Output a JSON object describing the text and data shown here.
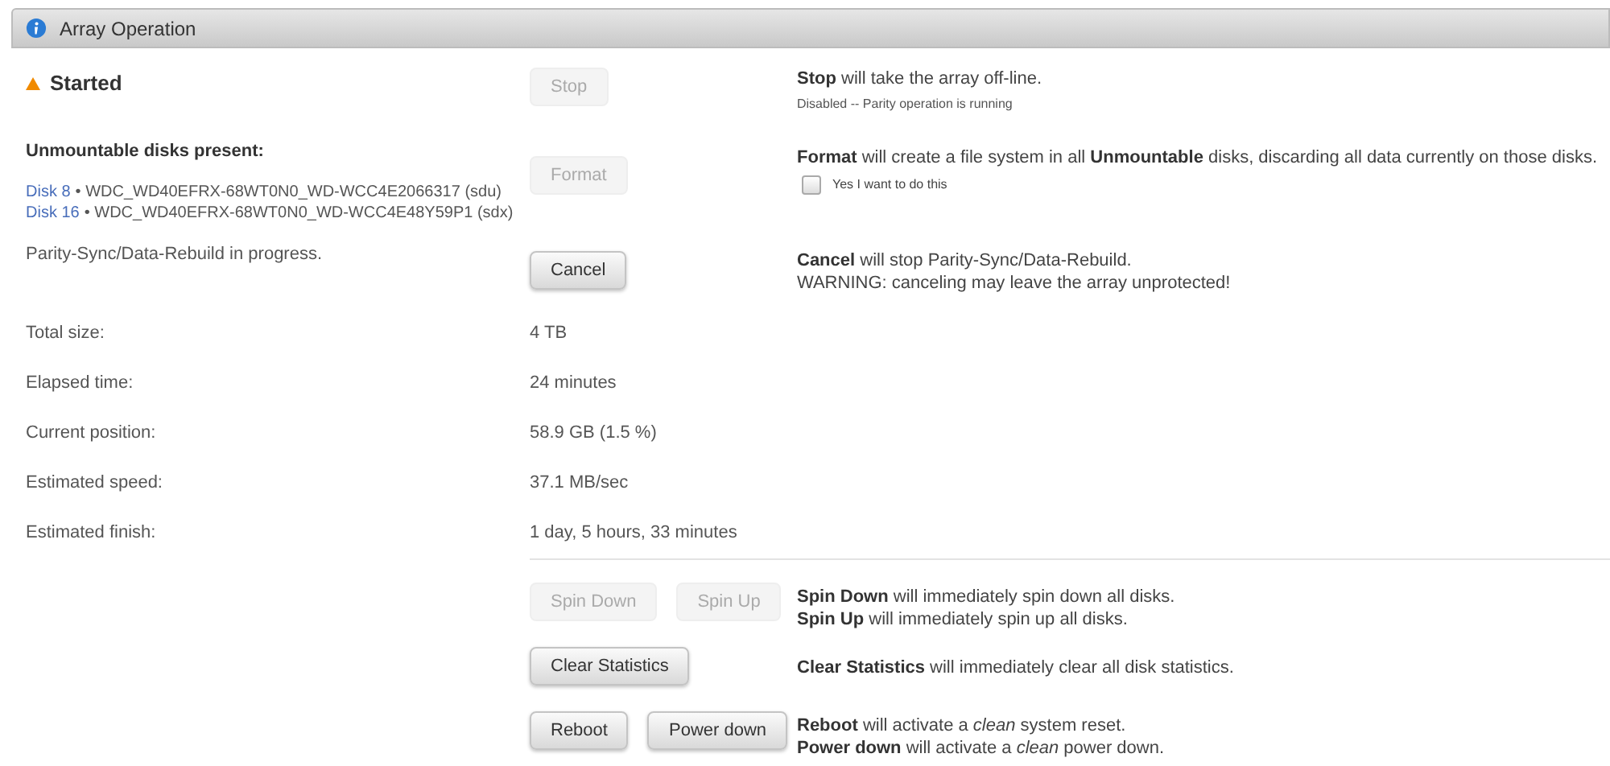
{
  "panel": {
    "title": "Array Operation"
  },
  "status": {
    "label": "Started"
  },
  "sections": [
    {
      "kind": "status",
      "buttons": [
        {
          "label": "Stop",
          "disabled": true
        }
      ],
      "lines": [
        "**Stop** will take the array off-line."
      ],
      "note": "Disabled -- Parity operation is running"
    },
    {
      "kind": "disks",
      "heading": "Unmountable disks present:",
      "disks": [
        {
          "link": "Disk 8",
          "text": "• WDC_WD40EFRX-68WT0N0_WD-WCC4E2066317 (sdu)"
        },
        {
          "link": "Disk 16",
          "text": "• WDC_WD40EFRX-68WT0N0_WD-WCC4E48Y59P1 (sdx)"
        }
      ],
      "buttons": [
        {
          "label": "Format",
          "disabled": true
        }
      ],
      "lines": [
        "**Format** will create a file system in all **Unmountable** disks, discarding all data currently on those disks."
      ],
      "checkbox": {
        "label": "Yes I want to do this",
        "checked": false
      }
    },
    {
      "kind": "text",
      "text": "Parity-Sync/Data-Rebuild in progress.",
      "buttons": [
        {
          "label": "Cancel",
          "disabled": false
        }
      ],
      "lines": [
        "**Cancel** will stop Parity-Sync/Data-Rebuild.",
        "WARNING: canceling may leave the array unprotected!"
      ]
    }
  ],
  "stats": [
    {
      "label": "Total size:",
      "value": "4 TB"
    },
    {
      "label": "Elapsed time:",
      "value": "24 minutes"
    },
    {
      "label": "Current position:",
      "value": "58.9 GB (1.5 %)"
    },
    {
      "label": "Estimated speed:",
      "value": "37.1 MB/sec"
    },
    {
      "label": "Estimated finish:",
      "value": "1 day, 5 hours, 33 minutes"
    }
  ],
  "actions": [
    {
      "buttons": [
        {
          "label": "Spin Down",
          "disabled": true
        },
        {
          "label": "Spin Up",
          "disabled": true
        }
      ],
      "lines": [
        "**Spin Down** will immediately spin down all disks.",
        "**Spin Up** will immediately spin up all disks."
      ]
    },
    {
      "buttons": [
        {
          "label": "Clear Statistics",
          "disabled": false
        }
      ],
      "lines": [
        "**Clear Statistics** will immediately clear all disk statistics."
      ]
    },
    {
      "buttons": [
        {
          "label": "Reboot",
          "disabled": false
        },
        {
          "label": "Power down",
          "disabled": false
        }
      ],
      "lines": [
        "**Reboot** will activate a *clean* system reset.",
        "**Power down** will activate a *clean* power down."
      ]
    }
  ]
}
